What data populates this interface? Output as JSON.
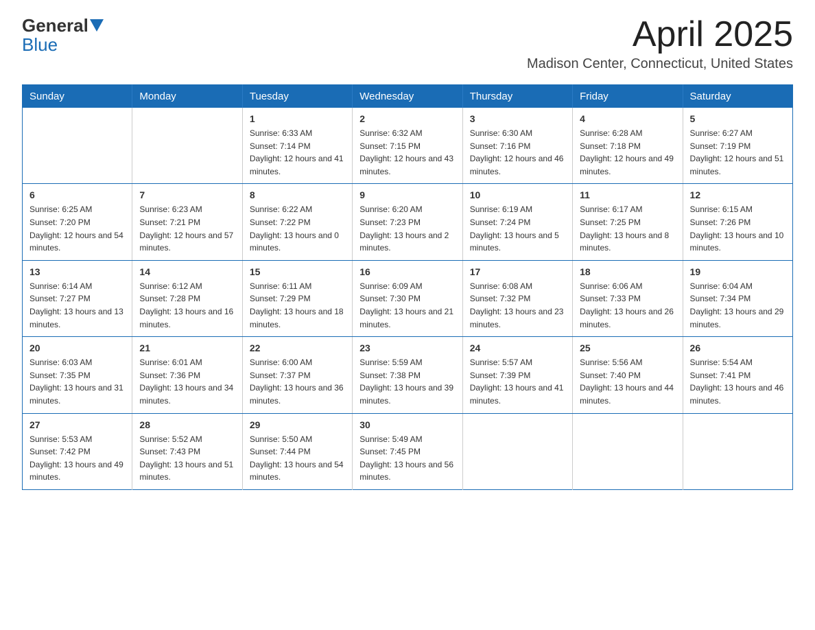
{
  "logo": {
    "text_general": "General",
    "text_blue": "Blue"
  },
  "header": {
    "month_title": "April 2025",
    "location": "Madison Center, Connecticut, United States"
  },
  "days_of_week": [
    "Sunday",
    "Monday",
    "Tuesday",
    "Wednesday",
    "Thursday",
    "Friday",
    "Saturday"
  ],
  "weeks": [
    [
      {
        "day": "",
        "sunrise": "",
        "sunset": "",
        "daylight": ""
      },
      {
        "day": "",
        "sunrise": "",
        "sunset": "",
        "daylight": ""
      },
      {
        "day": "1",
        "sunrise": "Sunrise: 6:33 AM",
        "sunset": "Sunset: 7:14 PM",
        "daylight": "Daylight: 12 hours and 41 minutes."
      },
      {
        "day": "2",
        "sunrise": "Sunrise: 6:32 AM",
        "sunset": "Sunset: 7:15 PM",
        "daylight": "Daylight: 12 hours and 43 minutes."
      },
      {
        "day": "3",
        "sunrise": "Sunrise: 6:30 AM",
        "sunset": "Sunset: 7:16 PM",
        "daylight": "Daylight: 12 hours and 46 minutes."
      },
      {
        "day": "4",
        "sunrise": "Sunrise: 6:28 AM",
        "sunset": "Sunset: 7:18 PM",
        "daylight": "Daylight: 12 hours and 49 minutes."
      },
      {
        "day": "5",
        "sunrise": "Sunrise: 6:27 AM",
        "sunset": "Sunset: 7:19 PM",
        "daylight": "Daylight: 12 hours and 51 minutes."
      }
    ],
    [
      {
        "day": "6",
        "sunrise": "Sunrise: 6:25 AM",
        "sunset": "Sunset: 7:20 PM",
        "daylight": "Daylight: 12 hours and 54 minutes."
      },
      {
        "day": "7",
        "sunrise": "Sunrise: 6:23 AM",
        "sunset": "Sunset: 7:21 PM",
        "daylight": "Daylight: 12 hours and 57 minutes."
      },
      {
        "day": "8",
        "sunrise": "Sunrise: 6:22 AM",
        "sunset": "Sunset: 7:22 PM",
        "daylight": "Daylight: 13 hours and 0 minutes."
      },
      {
        "day": "9",
        "sunrise": "Sunrise: 6:20 AM",
        "sunset": "Sunset: 7:23 PM",
        "daylight": "Daylight: 13 hours and 2 minutes."
      },
      {
        "day": "10",
        "sunrise": "Sunrise: 6:19 AM",
        "sunset": "Sunset: 7:24 PM",
        "daylight": "Daylight: 13 hours and 5 minutes."
      },
      {
        "day": "11",
        "sunrise": "Sunrise: 6:17 AM",
        "sunset": "Sunset: 7:25 PM",
        "daylight": "Daylight: 13 hours and 8 minutes."
      },
      {
        "day": "12",
        "sunrise": "Sunrise: 6:15 AM",
        "sunset": "Sunset: 7:26 PM",
        "daylight": "Daylight: 13 hours and 10 minutes."
      }
    ],
    [
      {
        "day": "13",
        "sunrise": "Sunrise: 6:14 AM",
        "sunset": "Sunset: 7:27 PM",
        "daylight": "Daylight: 13 hours and 13 minutes."
      },
      {
        "day": "14",
        "sunrise": "Sunrise: 6:12 AM",
        "sunset": "Sunset: 7:28 PM",
        "daylight": "Daylight: 13 hours and 16 minutes."
      },
      {
        "day": "15",
        "sunrise": "Sunrise: 6:11 AM",
        "sunset": "Sunset: 7:29 PM",
        "daylight": "Daylight: 13 hours and 18 minutes."
      },
      {
        "day": "16",
        "sunrise": "Sunrise: 6:09 AM",
        "sunset": "Sunset: 7:30 PM",
        "daylight": "Daylight: 13 hours and 21 minutes."
      },
      {
        "day": "17",
        "sunrise": "Sunrise: 6:08 AM",
        "sunset": "Sunset: 7:32 PM",
        "daylight": "Daylight: 13 hours and 23 minutes."
      },
      {
        "day": "18",
        "sunrise": "Sunrise: 6:06 AM",
        "sunset": "Sunset: 7:33 PM",
        "daylight": "Daylight: 13 hours and 26 minutes."
      },
      {
        "day": "19",
        "sunrise": "Sunrise: 6:04 AM",
        "sunset": "Sunset: 7:34 PM",
        "daylight": "Daylight: 13 hours and 29 minutes."
      }
    ],
    [
      {
        "day": "20",
        "sunrise": "Sunrise: 6:03 AM",
        "sunset": "Sunset: 7:35 PM",
        "daylight": "Daylight: 13 hours and 31 minutes."
      },
      {
        "day": "21",
        "sunrise": "Sunrise: 6:01 AM",
        "sunset": "Sunset: 7:36 PM",
        "daylight": "Daylight: 13 hours and 34 minutes."
      },
      {
        "day": "22",
        "sunrise": "Sunrise: 6:00 AM",
        "sunset": "Sunset: 7:37 PM",
        "daylight": "Daylight: 13 hours and 36 minutes."
      },
      {
        "day": "23",
        "sunrise": "Sunrise: 5:59 AM",
        "sunset": "Sunset: 7:38 PM",
        "daylight": "Daylight: 13 hours and 39 minutes."
      },
      {
        "day": "24",
        "sunrise": "Sunrise: 5:57 AM",
        "sunset": "Sunset: 7:39 PM",
        "daylight": "Daylight: 13 hours and 41 minutes."
      },
      {
        "day": "25",
        "sunrise": "Sunrise: 5:56 AM",
        "sunset": "Sunset: 7:40 PM",
        "daylight": "Daylight: 13 hours and 44 minutes."
      },
      {
        "day": "26",
        "sunrise": "Sunrise: 5:54 AM",
        "sunset": "Sunset: 7:41 PM",
        "daylight": "Daylight: 13 hours and 46 minutes."
      }
    ],
    [
      {
        "day": "27",
        "sunrise": "Sunrise: 5:53 AM",
        "sunset": "Sunset: 7:42 PM",
        "daylight": "Daylight: 13 hours and 49 minutes."
      },
      {
        "day": "28",
        "sunrise": "Sunrise: 5:52 AM",
        "sunset": "Sunset: 7:43 PM",
        "daylight": "Daylight: 13 hours and 51 minutes."
      },
      {
        "day": "29",
        "sunrise": "Sunrise: 5:50 AM",
        "sunset": "Sunset: 7:44 PM",
        "daylight": "Daylight: 13 hours and 54 minutes."
      },
      {
        "day": "30",
        "sunrise": "Sunrise: 5:49 AM",
        "sunset": "Sunset: 7:45 PM",
        "daylight": "Daylight: 13 hours and 56 minutes."
      },
      {
        "day": "",
        "sunrise": "",
        "sunset": "",
        "daylight": ""
      },
      {
        "day": "",
        "sunrise": "",
        "sunset": "",
        "daylight": ""
      },
      {
        "day": "",
        "sunrise": "",
        "sunset": "",
        "daylight": ""
      }
    ]
  ]
}
